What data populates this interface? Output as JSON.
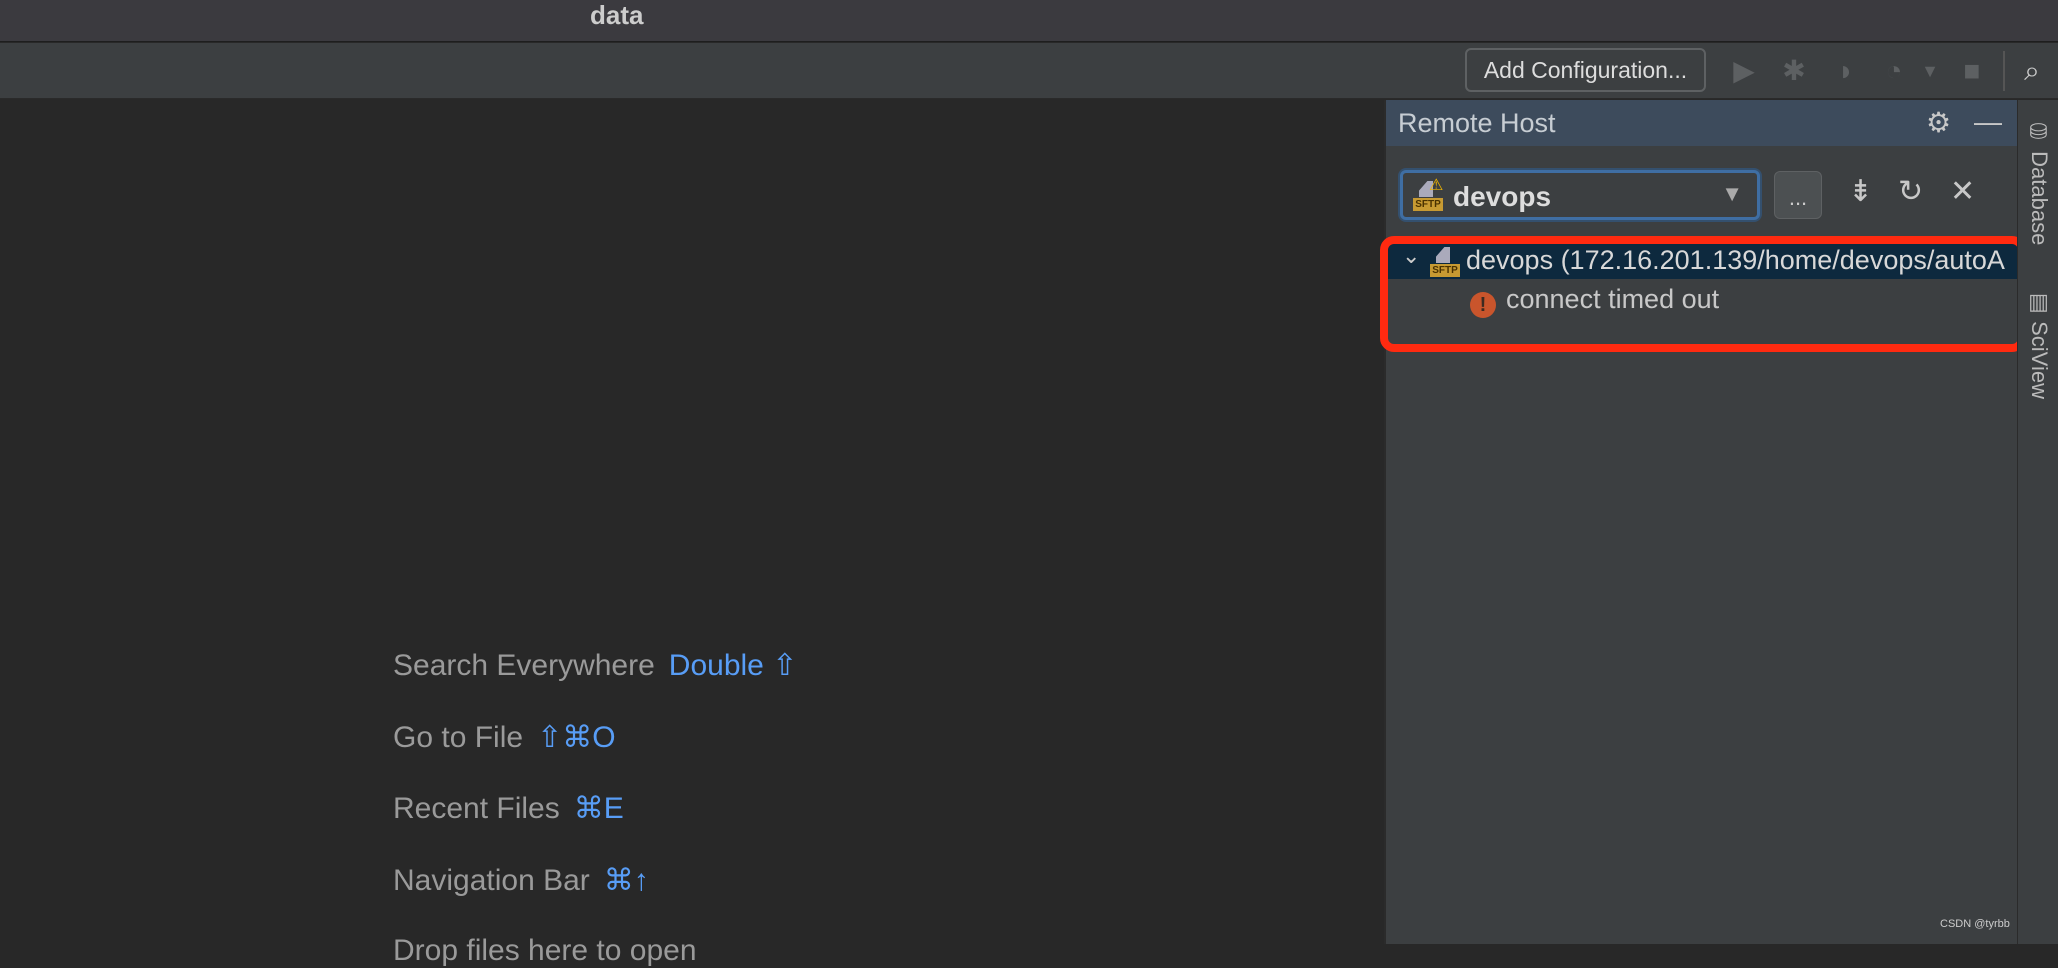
{
  "window": {
    "title": "data"
  },
  "toolbar": {
    "add_configuration": "Add Configuration...",
    "icons": [
      "run-icon",
      "debug-icon",
      "coverage-icon",
      "profile-icon",
      "dropdown-icon",
      "stop-icon",
      "search-icon"
    ]
  },
  "editor_hints": [
    {
      "label": "Search Everywhere",
      "shortcut": "Double ⇧"
    },
    {
      "label": "Go to File",
      "shortcut": "⇧⌘O"
    },
    {
      "label": "Recent Files",
      "shortcut": "⌘E"
    },
    {
      "label": "Navigation Bar",
      "shortcut": "⌘↑"
    },
    {
      "label": "Drop files here to open",
      "shortcut": ""
    }
  ],
  "remote_host": {
    "title": "Remote Host",
    "server_select": "devops",
    "more_label": "...",
    "tree": {
      "root": "devops (172.16.201.139/home/devops/autoA",
      "error": "connect timed out"
    },
    "highlight_color": "#ff2a10"
  },
  "right_stripe": {
    "tabs": [
      "Database",
      "SciView"
    ]
  },
  "watermark": "CSDN @tyrbb"
}
